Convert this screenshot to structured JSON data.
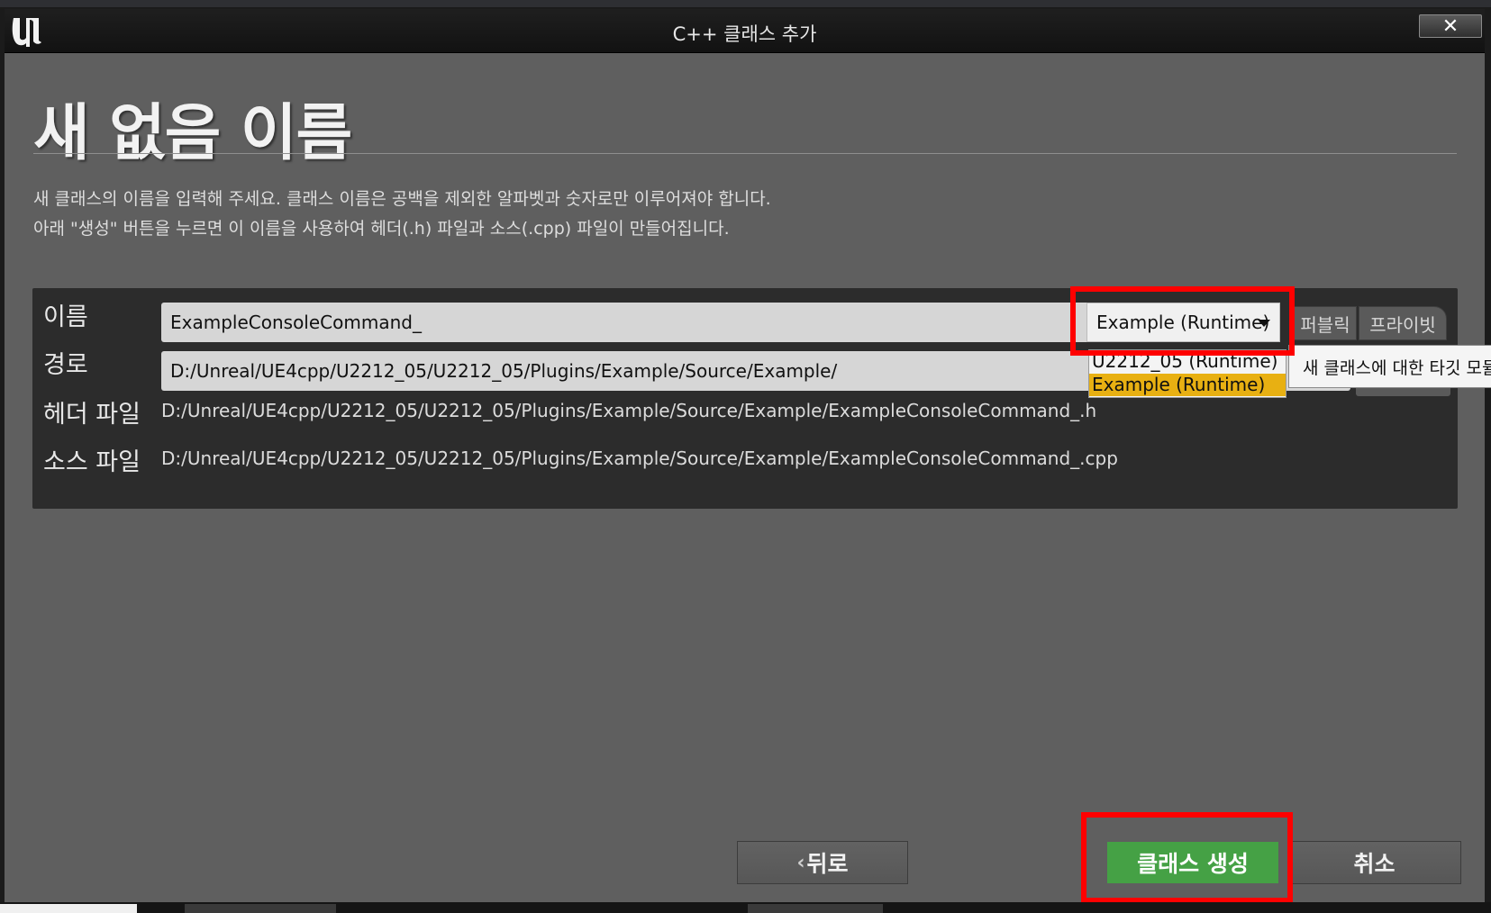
{
  "window": {
    "title": "C++ 클래스 추가",
    "close_glyph": "✕"
  },
  "page": {
    "heading": "새 없음 이름",
    "description_line1": "새 클래스의 이름을 입력해 주세요. 클래스 이름은 공백을 제외한 알파벳과 숫자로만 이루어져야 합니다.",
    "description_line2": "아래 \"생성\" 버튼을 누르면 이 이름을 사용하여 헤더(.h) 파일과 소스(.cpp) 파일이 만들어집니다."
  },
  "form": {
    "name_label": "이름",
    "name_value": "ExampleConsoleCommand_",
    "path_label": "경로",
    "path_value": "D:/Unreal/UE4cpp/U2212_05/U2212_05/Plugins/Example/Source/Example/",
    "header_label": "헤더 파일",
    "header_value": "D:/Unreal/UE4cpp/U2212_05/U2212_05/Plugins/Example/Source/Example/ExampleConsoleCommand_.h",
    "source_label": "소스 파일",
    "source_value": "D:/Unreal/UE4cpp/U2212_05/U2212_05/Plugins/Example/Source/Example/ExampleConsoleCommand_.cpp"
  },
  "module": {
    "selected": "Example (Runtime)",
    "options": [
      "U2212_05 (Runtime)",
      "Example (Runtime)"
    ],
    "tooltip": "새 클래스에 대한 타깃 모듈"
  },
  "visibility": {
    "public_label": "퍼블릭",
    "private_label": "프라이빗"
  },
  "buttons": {
    "back_label": "뒤로",
    "back_glyph": "‹",
    "create_label": "클래스 생성",
    "cancel_label": "취소"
  },
  "colors": {
    "accent_highlight": "#ff0000",
    "create_button": "#45a145",
    "selected_option": "#e8b012"
  }
}
